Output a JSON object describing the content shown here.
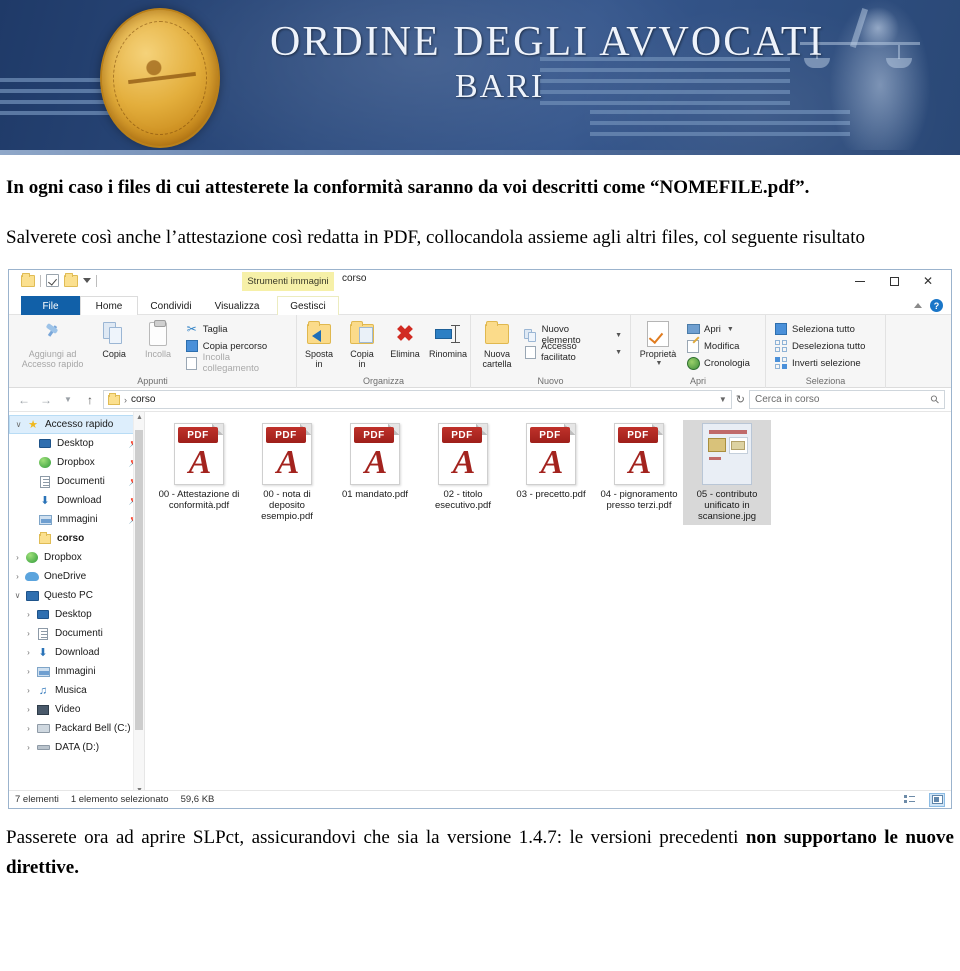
{
  "banner": {
    "title": "ORDINE DEGLI AVVOCATI",
    "subtitle": "BARI",
    "seal_name": "seal-medallion",
    "colors": {
      "blue_dark": "#1f3a68",
      "blue_mid": "#2e4d80",
      "gold": "#e3ae3c"
    }
  },
  "doc": {
    "para1_bold": "In ogni caso i files di cui attesterete la conformità saranno da voi descritti come “NOMEFILE.pdf”.",
    "para2": "Salverete così anche l’attestazione così redatta in PDF, collocandola assieme agli altri files, col seguente risultato",
    "para3_lead": "Passerete ora ad aprire SLPct, assicurandovi che sia la versione 1.4.7: le versioni precedenti ",
    "para3_bold1": "non supportano le nuove direttive.",
    "para3_bold_inline": "non"
  },
  "explorer": {
    "window_title": "corso",
    "contextual_tab": "Strumenti immagini",
    "window_buttons": {
      "minimize": "minimize-icon",
      "maximize": "maximize-icon",
      "close": "close-icon"
    },
    "help": {
      "collapse_ribbon": "chevron-up-icon",
      "help": "?"
    },
    "quick_access": [
      "folder-icon",
      "properties-checkbox-icon",
      "new-folder-icon",
      "customize-caret-icon"
    ],
    "tabs": [
      {
        "label": "File",
        "active": false,
        "style": "file"
      },
      {
        "label": "Home",
        "active": true
      },
      {
        "label": "Condividi",
        "active": false
      },
      {
        "label": "Visualizza",
        "active": false
      },
      {
        "label": "Gestisci",
        "active": false,
        "contextual": true
      }
    ],
    "ribbon": {
      "groups": [
        {
          "label": "Appunti",
          "big": [
            {
              "label": "Aggiungi ad\nAccesso rapido",
              "icon": "pin-icon",
              "disabled": true
            },
            {
              "label": "Copia",
              "icon": "copy-icon",
              "disabled": false
            },
            {
              "label": "Incolla",
              "icon": "paste-icon",
              "disabled": true
            }
          ],
          "small": [
            {
              "label": "Taglia",
              "icon": "scissors-icon",
              "disabled": false
            },
            {
              "label": "Copia percorso",
              "icon": "copy-path-icon",
              "disabled": false
            },
            {
              "label": "Incolla collegamento",
              "icon": "paste-shortcut-icon",
              "disabled": true
            }
          ]
        },
        {
          "label": "Organizza",
          "big": [
            {
              "label": "Sposta\nin",
              "icon": "move-to-icon",
              "dropdown": true
            },
            {
              "label": "Copia\nin",
              "icon": "copy-to-icon",
              "dropdown": true
            },
            {
              "label": "Elimina",
              "icon": "delete-x-icon",
              "dropdown": true
            },
            {
              "label": "Rinomina",
              "icon": "rename-icon"
            }
          ],
          "small": []
        },
        {
          "label": "Nuovo",
          "big": [
            {
              "label": "Nuova\ncartella",
              "icon": "new-folder-icon"
            }
          ],
          "small": [
            {
              "label": "Nuovo elemento",
              "icon": "new-item-icon",
              "dropdown": true
            },
            {
              "label": "Accesso facilitato",
              "icon": "easy-access-icon",
              "dropdown": true
            }
          ]
        },
        {
          "label": "Apri",
          "big": [
            {
              "label": "Proprietà",
              "icon": "properties-icon",
              "dropdown": true
            }
          ],
          "small": [
            {
              "label": "Apri",
              "icon": "open-icon",
              "dropdown": true
            },
            {
              "label": "Modifica",
              "icon": "edit-icon"
            },
            {
              "label": "Cronologia",
              "icon": "history-icon"
            }
          ]
        },
        {
          "label": "Seleziona",
          "big": [],
          "small": [
            {
              "label": "Seleziona tutto",
              "icon": "select-all-icon"
            },
            {
              "label": "Deseleziona tutto",
              "icon": "select-none-icon"
            },
            {
              "label": "Inverti selezione",
              "icon": "invert-selection-icon"
            }
          ]
        }
      ]
    },
    "addressbar": {
      "back": "back-arrow-icon",
      "forward": "forward-arrow-icon",
      "recent": "recent-caret-icon",
      "up": "up-arrow-icon",
      "breadcrumb": "corso",
      "breadcrumb_sep": "›",
      "dropdown": "∨",
      "refresh": "↻",
      "search_placeholder": "Cerca in corso",
      "search_value": ""
    },
    "navpane": {
      "items": [
        {
          "label": "Accesso rapido",
          "icon": "star-icon",
          "chev": "∨",
          "indent": 0,
          "selected": true
        },
        {
          "label": "Desktop",
          "icon": "desktop-icon",
          "chev": "",
          "indent": 1,
          "pinned": true
        },
        {
          "label": "Dropbox",
          "icon": "dropbox-icon",
          "chev": "",
          "indent": 1,
          "pinned": true
        },
        {
          "label": "Documenti",
          "icon": "documents-icon",
          "chev": "",
          "indent": 1,
          "pinned": true
        },
        {
          "label": "Download",
          "icon": "download-icon",
          "chev": "",
          "indent": 1,
          "pinned": true
        },
        {
          "label": "Immagini",
          "icon": "pictures-icon",
          "chev": "",
          "indent": 1,
          "pinned": true
        },
        {
          "label": "corso",
          "icon": "folder-icon",
          "chev": "",
          "indent": 1,
          "pinned": false
        },
        {
          "label": "Dropbox",
          "icon": "dropbox-icon",
          "chev": "›",
          "indent": 0
        },
        {
          "label": "OneDrive",
          "icon": "onedrive-icon",
          "chev": "›",
          "indent": 0
        },
        {
          "label": "Questo PC",
          "icon": "this-pc-icon",
          "chev": "∨",
          "indent": 0
        },
        {
          "label": "Desktop",
          "icon": "desktop-icon",
          "chev": "›",
          "indent": 1
        },
        {
          "label": "Documenti",
          "icon": "documents-icon",
          "chev": "›",
          "indent": 1
        },
        {
          "label": "Download",
          "icon": "download-icon",
          "chev": "›",
          "indent": 1
        },
        {
          "label": "Immagini",
          "icon": "pictures-icon",
          "chev": "›",
          "indent": 1
        },
        {
          "label": "Musica",
          "icon": "music-icon",
          "chev": "›",
          "indent": 1
        },
        {
          "label": "Video",
          "icon": "video-icon",
          "chev": "›",
          "indent": 1
        },
        {
          "label": "Packard Bell (C:)",
          "icon": "drive-icon",
          "chev": "›",
          "indent": 1
        },
        {
          "label": "DATA (D:)",
          "icon": "drive-icon",
          "chev": "›",
          "indent": 1
        }
      ]
    },
    "files": [
      {
        "name": "00 - Attestazione di conformità.pdf",
        "type": "pdf",
        "selected": false
      },
      {
        "name": "00 - nota di deposito esempio.pdf",
        "type": "pdf",
        "selected": false
      },
      {
        "name": "01 mandato.pdf",
        "type": "pdf",
        "selected": false
      },
      {
        "name": "02 - titolo esecutivo.pdf",
        "type": "pdf",
        "selected": false
      },
      {
        "name": "03 - precetto.pdf",
        "type": "pdf",
        "selected": false
      },
      {
        "name": "04 - pignoramento presso terzi.pdf",
        "type": "pdf",
        "selected": false
      },
      {
        "name": "05 - contributo unificato in scansione.jpg",
        "type": "jpg",
        "selected": true
      }
    ],
    "statusbar": {
      "count": "7 elementi",
      "selection": "1 elemento selezionato",
      "size": "59,6 KB",
      "view_details": "details-view-icon",
      "view_thumbnails": "thumbnails-view-icon"
    }
  }
}
